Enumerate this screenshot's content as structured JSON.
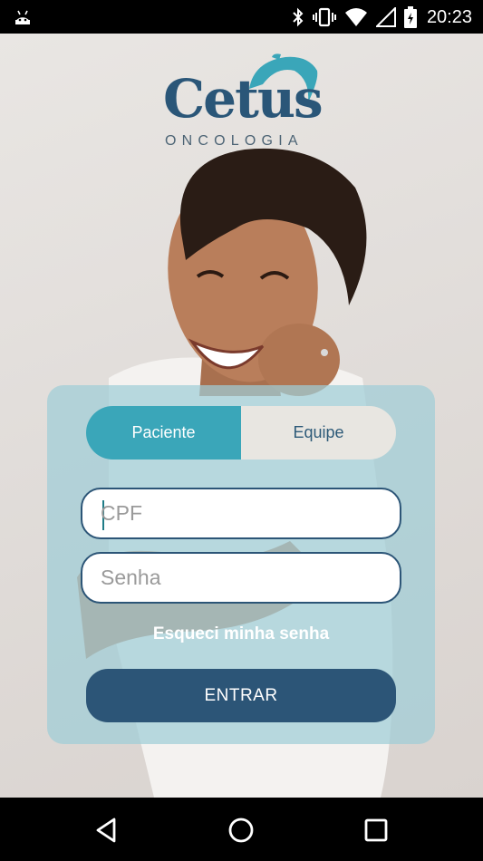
{
  "status_bar": {
    "time": "20:23",
    "icons": [
      "android-icon",
      "bluetooth-icon",
      "vibrate-icon",
      "wifi-icon",
      "signal-icon",
      "battery-icon"
    ]
  },
  "logo": {
    "name": "Cetus",
    "subtitle": "ONCOLOGIA"
  },
  "login": {
    "tabs": [
      {
        "label": "Paciente",
        "selected": true
      },
      {
        "label": "Equipe",
        "selected": false
      }
    ],
    "cpf_placeholder": "CPF",
    "password_placeholder": "Senha",
    "forgot_label": "Esqueci minha senha",
    "submit_label": "ENTRAR"
  },
  "colors": {
    "brand_dark": "#2c5577",
    "brand_teal": "#3aa6b9",
    "panel": "#a0cdd7"
  },
  "nav_bar": {
    "icons": [
      "back-icon",
      "home-icon",
      "recents-icon"
    ]
  }
}
